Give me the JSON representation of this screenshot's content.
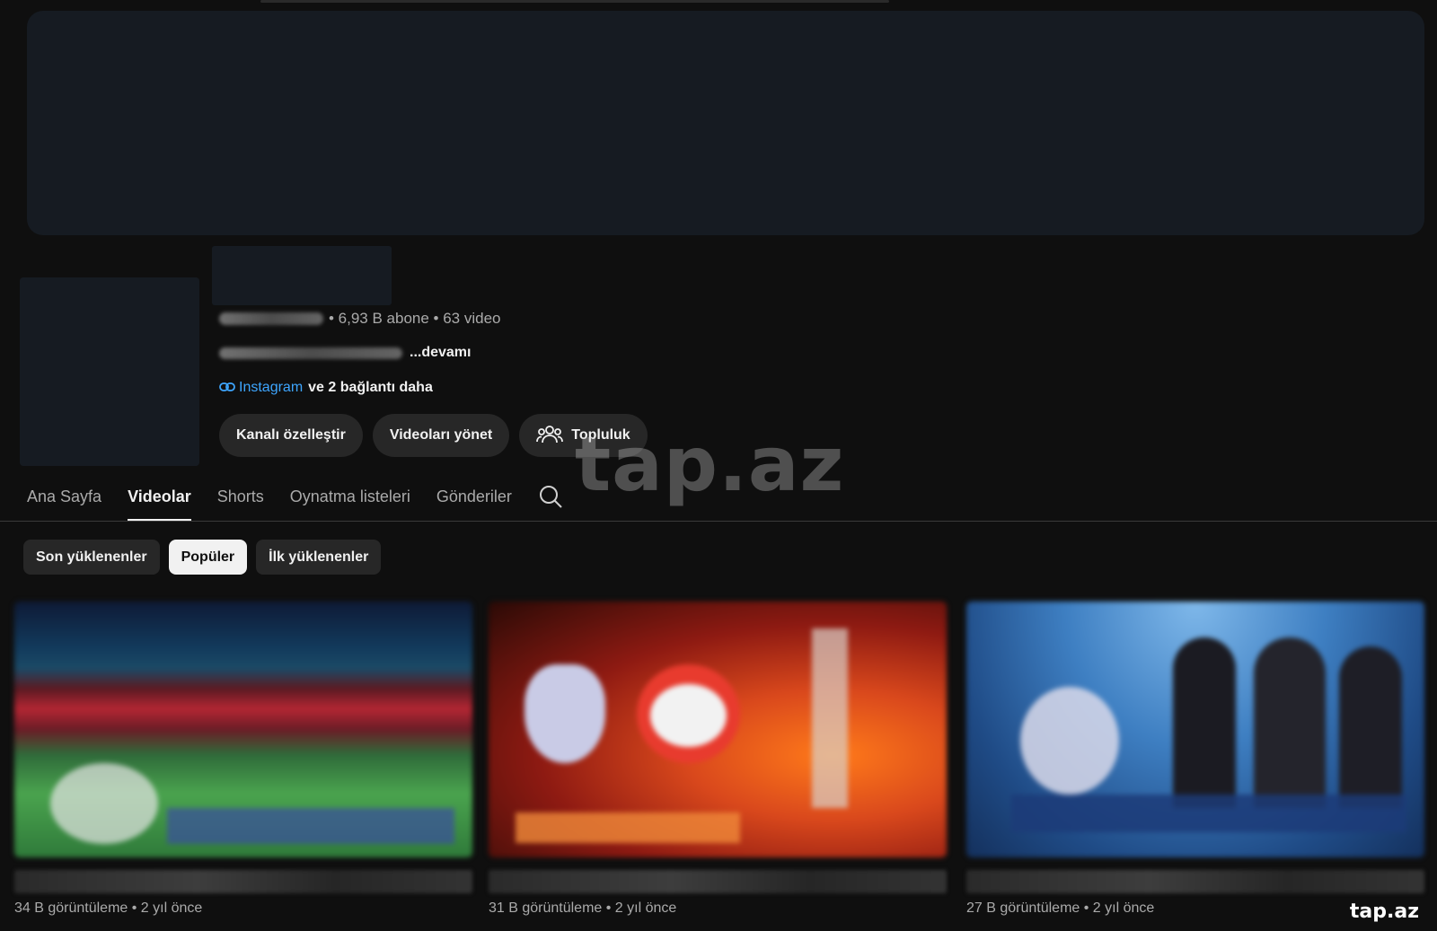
{
  "channel": {
    "stats": "• 6,93 B abone • 63 video",
    "description_more": "...devamı",
    "links": {
      "primary": "Instagram",
      "more": "ve 2 bağlantı daha"
    }
  },
  "actions": {
    "customize": "Kanalı özelleştir",
    "manage_videos": "Videoları yönet",
    "community": "Topluluk"
  },
  "tabs": [
    {
      "label": "Ana Sayfa"
    },
    {
      "label": "Videolar"
    },
    {
      "label": "Shorts"
    },
    {
      "label": "Oynatma listeleri"
    },
    {
      "label": "Gönderiler"
    }
  ],
  "active_tab": "Videolar",
  "sort_chips": [
    {
      "label": "Son yüklenenler"
    },
    {
      "label": "Popüler"
    },
    {
      "label": "İlk yüklenenler"
    }
  ],
  "selected_chip": "Popüler",
  "videos": [
    {
      "meta": "34 B görüntüleme • 2 yıl önce"
    },
    {
      "meta": "31 B görüntüleme • 2 yıl önce"
    },
    {
      "meta": "27 B görüntüleme • 2 yıl önce"
    }
  ],
  "watermarks": {
    "center": "tap.az",
    "corner": "tap.az"
  },
  "colors": {
    "background": "#0f0f0f",
    "link": "#3ea6ff",
    "chip_selected": "#f1f1f1"
  },
  "icons": [
    "link-icon",
    "community-icon",
    "search-icon"
  ]
}
